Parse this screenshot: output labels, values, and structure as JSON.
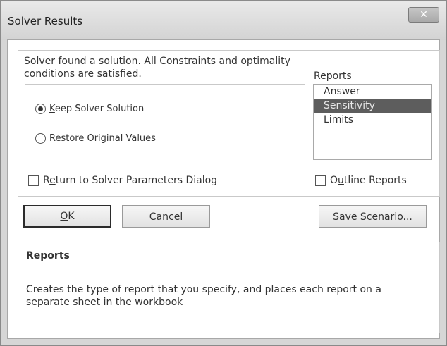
{
  "window": {
    "title": "Solver Results",
    "close_glyph": "✕"
  },
  "message": {
    "line1": "Solver found a solution.  All Constraints and optimality",
    "line2": "conditions are satisfied."
  },
  "options": {
    "keep": {
      "pre": "",
      "ul": "K",
      "post": "eep Solver Solution",
      "checked": true
    },
    "restore": {
      "pre": "",
      "ul": "R",
      "post": "estore Original Values",
      "checked": false
    }
  },
  "reports": {
    "label_pre": "Re",
    "label_ul": "p",
    "label_post": "orts",
    "items": [
      "Answer",
      "Sensitivity",
      "Limits"
    ],
    "selected": "Sensitivity"
  },
  "return_checkbox": {
    "pre": "R",
    "ul": "e",
    "post": "turn to Solver Parameters Dialog",
    "checked": false
  },
  "outline_checkbox": {
    "pre": "O",
    "ul": "u",
    "post": "tline Reports",
    "checked": false
  },
  "buttons": {
    "ok": {
      "ul": "O",
      "post": "K"
    },
    "cancel": {
      "ul": "C",
      "post": "ancel"
    },
    "save": {
      "ul": "S",
      "post": "ave Scenario..."
    }
  },
  "help": {
    "title": "Reports",
    "text": "Creates the type of report that you specify, and places each report on a separate sheet in the workbook"
  },
  "colors": {
    "selection": "#5d5d5d",
    "window_bg": "#d6d6d6"
  }
}
